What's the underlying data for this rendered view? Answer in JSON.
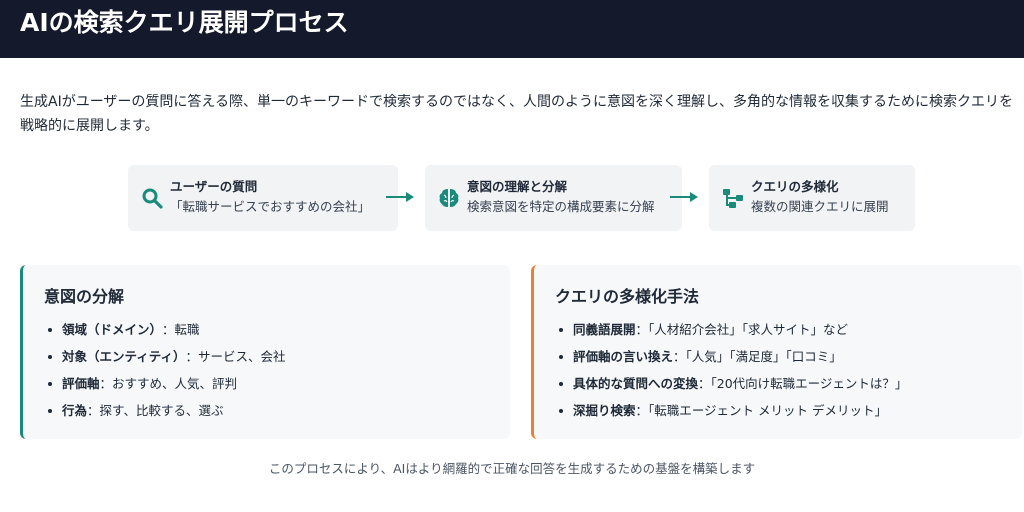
{
  "header": {
    "title": "AIの検索クエリ展開プロセス"
  },
  "intro": "生成AIがユーザーの質問に答える際、単一のキーワードで検索するのではなく、人間のように意図を深く理解し、多角的な情報を収集するために検索クエリを戦略的に展開します。",
  "flow": [
    {
      "title": "ユーザーの質問",
      "subtitle": "「転職サービスでおすすめの会社」",
      "icon": "search-icon"
    },
    {
      "title": "意図の理解と分解",
      "subtitle": "検索意図を特定の構成要素に分解",
      "icon": "brain-icon"
    },
    {
      "title": "クエリの多様化",
      "subtitle": "複数の関連クエリに展開",
      "icon": "hierarchy-icon"
    }
  ],
  "cards": {
    "left": {
      "title": "意図の分解",
      "items": [
        {
          "key": "領域（ドメイン）",
          "value": "：転職"
        },
        {
          "key": "対象（エンティティ）",
          "value": "：サービス、会社"
        },
        {
          "key": "評価軸",
          "value": "：おすすめ、人気、評判"
        },
        {
          "key": "行為",
          "value": "：探す、比較する、選ぶ"
        }
      ]
    },
    "right": {
      "title": "クエリの多様化手法",
      "items": [
        {
          "key": "同義語展開",
          "value": "：「人材紹介会社」「求人サイト」など"
        },
        {
          "key": "評価軸の言い換え",
          "value": "：「人気」「満足度」「口コミ」"
        },
        {
          "key": "具体的な質問への変換",
          "value": "：「20代向け転職エージェントは？」"
        },
        {
          "key": "深掘り検索",
          "value": "：「転職エージェント メリット デメリット」"
        }
      ]
    }
  },
  "footer": "このプロセスにより、AIはより網羅的で正確な回答を生成するための基盤を構築します",
  "colors": {
    "header_bg": "#141a2b",
    "accent_teal": "#1a8a7a",
    "accent_orange": "#e8803a"
  }
}
